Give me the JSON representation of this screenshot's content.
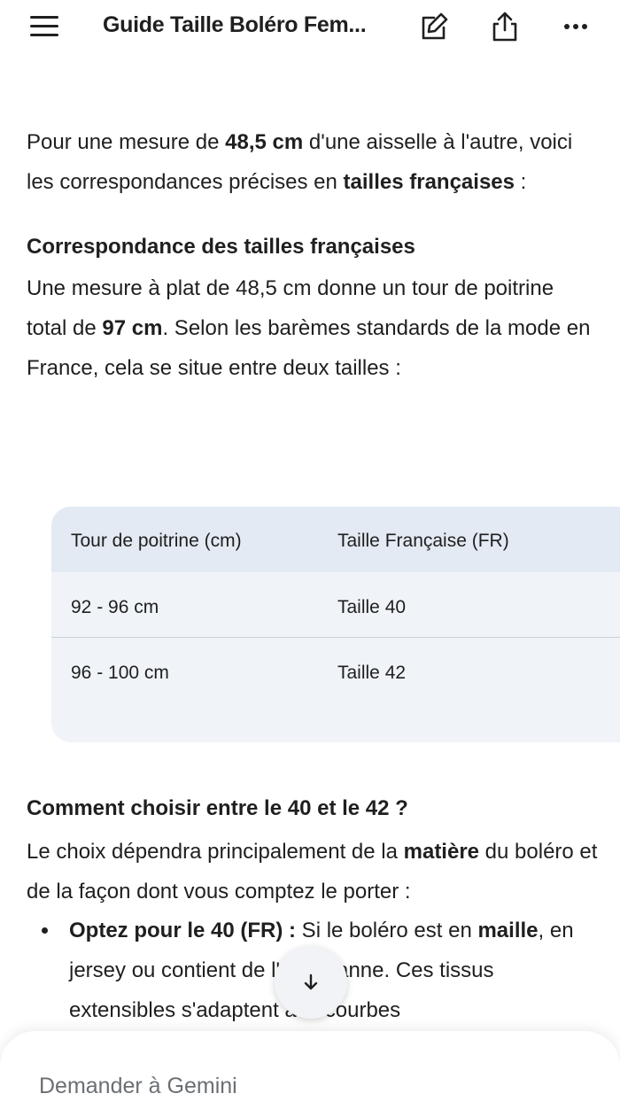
{
  "header": {
    "title": "Guide Taille Boléro Fem...",
    "icons": [
      "menu-icon",
      "edit-icon",
      "share-icon",
      "more-icon"
    ]
  },
  "intro": {
    "t1": "Pour une mesure de ",
    "b1": "48,5 cm",
    "t2": " d'une aisselle à l'autre, voici les correspondances précises en ",
    "b2": "tailles françaises",
    "t3": " :"
  },
  "section1": {
    "heading": "Correspondance des tailles françaises",
    "t1": "Une mesure à plat de 48,5 cm donne un tour de poitrine total de ",
    "b1": "97 cm",
    "t2": ". Selon les barèmes standards de la mode en France, cela se situe entre deux tailles :"
  },
  "table": {
    "headers": [
      "Tour de poitrine (cm)",
      "Taille Française (FR)"
    ],
    "rows": [
      [
        "92 - 96 cm",
        "Taille 40"
      ],
      [
        "96 - 100 cm",
        "Taille 42"
      ]
    ]
  },
  "section2": {
    "heading": "Comment choisir entre le 40 et le 42 ?",
    "t1": "Le choix dépendra principalement de la ",
    "b1": "matière",
    "t2": " du boléro et de la façon dont vous comptez le porter :",
    "bullet": {
      "b1": "Optez pour le 40 (FR) :",
      "t1": " Si le boléro est en ",
      "b2": "maille",
      "t2": ", en jersey ou contient de l'élasthanne. Ces tissus extensibles s'adaptent aux courbes"
    }
  },
  "input": {
    "placeholder": "Demander à Gemini"
  },
  "colors": {
    "table_header_bg": "#e3eaf3",
    "table_body_bg": "#f0f4f9",
    "text": "#1f1f1f"
  }
}
